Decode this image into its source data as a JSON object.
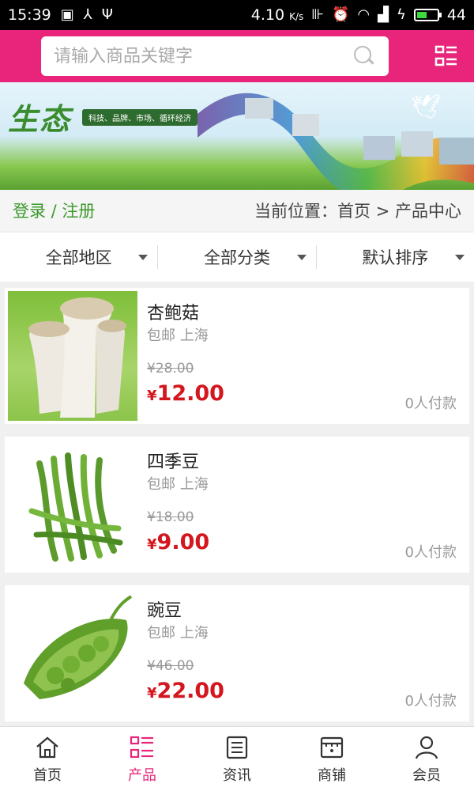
{
  "statusbar": {
    "time": "15:39",
    "speed": "4.10",
    "speed_unit": "K/s",
    "battery": "44"
  },
  "header": {
    "search_placeholder": "请输入商品关键字"
  },
  "banner": {
    "logo": "生态",
    "tagline": "科技、品牌、市场、循环经济"
  },
  "crumbs": {
    "login": "登录 / 注册",
    "location": "当前位置：首页 > 产品中心"
  },
  "filters": [
    {
      "label": "全部地区"
    },
    {
      "label": "全部分类"
    },
    {
      "label": "默认排序"
    }
  ],
  "products": [
    {
      "name": "杏鲍菇",
      "shipping": "包邮 上海",
      "old_price": "¥28.00",
      "currency": "¥",
      "price": "12.00",
      "paid": "0人付款"
    },
    {
      "name": "四季豆",
      "shipping": "包邮 上海",
      "old_price": "¥18.00",
      "currency": "¥",
      "price": "9.00",
      "paid": "0人付款"
    },
    {
      "name": "豌豆",
      "shipping": "包邮 上海",
      "old_price": "¥46.00",
      "currency": "¥",
      "price": "22.00",
      "paid": "0人付款"
    }
  ],
  "tabs": [
    {
      "label": "首页",
      "icon": "home-icon"
    },
    {
      "label": "产品",
      "icon": "product-grid-icon"
    },
    {
      "label": "资讯",
      "icon": "news-icon"
    },
    {
      "label": "商铺",
      "icon": "shop-icon"
    },
    {
      "label": "会员",
      "icon": "user-icon"
    }
  ],
  "colors": {
    "brand": "#e8257a",
    "price": "#d4161e",
    "login": "#3c9a2c"
  }
}
